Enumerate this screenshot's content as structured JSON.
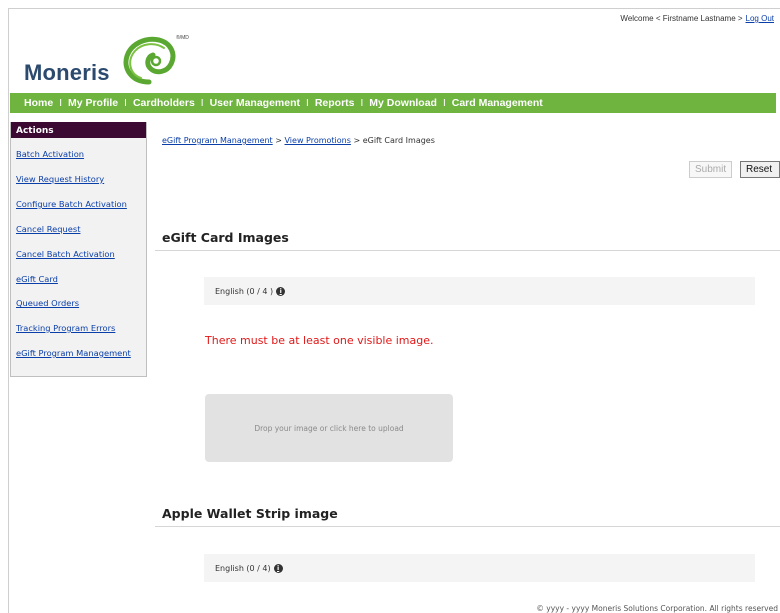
{
  "header": {
    "welcome_text": "Welcome < Firstname Lastname >",
    "logout_label": "Log Out",
    "logo_text": "Moneris",
    "logo_reg": "®/MD"
  },
  "nav": {
    "items": [
      "Home",
      "My Profile",
      "Cardholders",
      "User Management",
      "Reports",
      "My Download",
      "Card Management"
    ],
    "separator": "I"
  },
  "sidebar": {
    "title": "Actions",
    "items": [
      "Batch Activation",
      "View Request History",
      "Configure Batch Activation",
      "Cancel Request",
      "Cancel Batch Activation",
      "eGift Card",
      "Queued Orders",
      "Tracking Program Errors",
      "eGift Program Management"
    ]
  },
  "breadcrumb": {
    "item1": "eGift Program Management",
    "sep": ">",
    "item2": "View Promotions",
    "current": "eGift Card Images"
  },
  "buttons": {
    "submit": "Submit",
    "reset": "Reset"
  },
  "card_images": {
    "title": "eGift Card Images",
    "lang_label": "English (0 / 4 )",
    "error": "There must be at least one visible image.",
    "dropzone": "Drop your image or click here to upload"
  },
  "wallet": {
    "title": "Apple Wallet Strip image",
    "lang_label": "English (0 / 4)"
  },
  "info_glyph": "i",
  "footer": "© yyyy - yyyy  Moneris Solutions Corporation. All rights reserved",
  "colors": {
    "nav_green": "#6eb43f",
    "sidebar_header": "#3b0931",
    "link_blue": "#0a3ea8",
    "error_red": "#e01818",
    "logo_green": "#5aa832",
    "logo_navy": "#2b4a6e"
  }
}
